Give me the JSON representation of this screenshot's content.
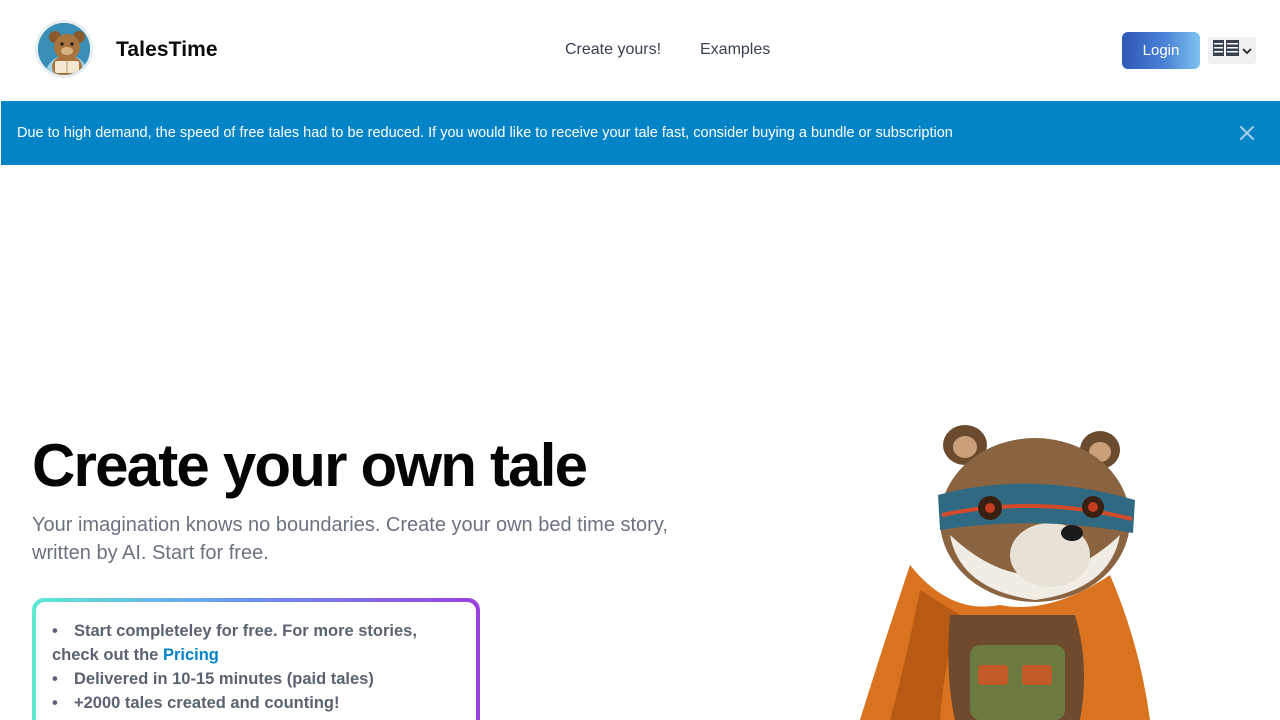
{
  "header": {
    "brand": "TalesTime",
    "nav": [
      {
        "label": "Create yours!"
      },
      {
        "label": "Examples"
      }
    ],
    "login_label": "Login"
  },
  "banner": {
    "text": "Due to high demand, the speed of free tales had to be reduced. If you would like to receive your tale fast, consider buying a bundle or subscription"
  },
  "hero": {
    "title": "Create your own tale",
    "subtitle": "Your imagination knows no boundaries. Create your own bed time story, written by AI. Start for free.",
    "features": {
      "item1_text": "Start completeley for free. For more stories, check out the ",
      "item1_link": "Pricing",
      "item2": "Delivered in 10-15 minutes (paid tales)",
      "item3": "+2000 tales created and counting!"
    }
  },
  "colors": {
    "banner": "#0284c7",
    "link": "#0284c7",
    "login_gradient_start": "#2d58b5",
    "login_gradient_end": "#7ec4ef"
  },
  "icons": [
    "bear-reading-logo",
    "english-flag-icon",
    "chevron-down-icon",
    "close-icon",
    "raccoon-hero-illustration"
  ]
}
